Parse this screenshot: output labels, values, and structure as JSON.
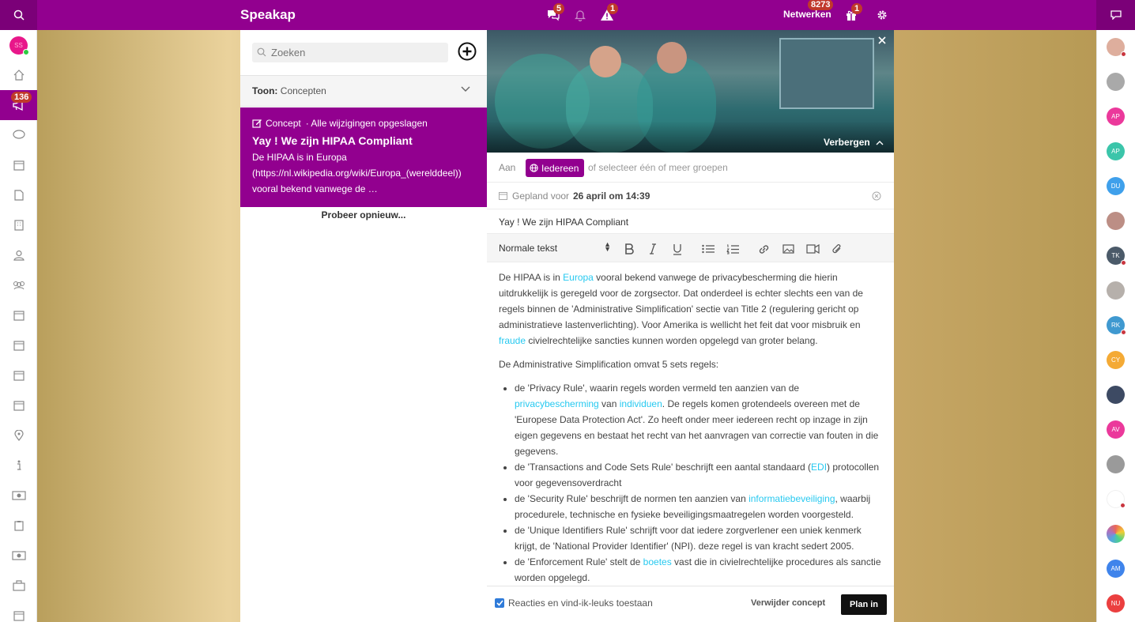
{
  "app": {
    "title": "Speakap"
  },
  "topbar": {
    "chat_badge": "5",
    "alert_badge": "1",
    "network_label": "Netwerken",
    "network_count": "8273",
    "gift_badge": "1"
  },
  "leftnav": {
    "avatar_initials": "SS",
    "active_badge": "136"
  },
  "list": {
    "search_placeholder": "Zoeken",
    "filter_label": "Toon:",
    "filter_value": "Concepten",
    "card": {
      "status": "Concept",
      "saved": "· Alle wijzigingen opgeslagen",
      "title": "Yay ! We zijn HIPAA Compliant",
      "line1": "De HIPAA is in Europa",
      "line2": "(https://nl.wikipedia.org/wiki/Europa_(werelddeel))",
      "line3": "vooral bekend vanwege de …"
    },
    "retry": "Probeer opnieuw..."
  },
  "editor": {
    "hide_label": "Verbergen",
    "to_label": "Aan",
    "audience": "Iedereen",
    "audience_hint": "of selecteer één of meer groepen",
    "schedule_label": "Gepland voor",
    "schedule_value": "26 april om 14:39",
    "title": "Yay ! We zijn HIPAA Compliant",
    "format": "Normale tekst",
    "p1a": "De HIPAA is in ",
    "p1_link1": "Europa",
    "p1b": " vooral bekend vanwege de privacybescherming die hierin uitdrukkelijk is geregeld voor de zorgsector. Dat onderdeel is echter slechts een van de regels binnen de 'Administrative Simplification' sectie van Title 2 (regulering gericht op administratieve lastenverlichting). Voor Amerika is wellicht het feit dat voor misbruik en ",
    "p1_link2": "fraude",
    "p1c": " civielrechtelijke sancties kunnen worden opgelegd van groter belang.",
    "p2": "De Administrative Simplification omvat 5 sets regels:",
    "li1a": "de 'Privacy Rule', waarin regels worden vermeld ten aanzien van de ",
    "li1_link1": "privacybescherming",
    "li1b": " van ",
    "li1_link2": "individuen",
    "li1c": ". De regels komen grotendeels overeen met de 'Europese Data Protection Act'. Zo heeft onder meer iedereen recht op inzage in zijn eigen gegevens en bestaat het recht van het aanvragen van correctie van fouten in die gegevens.",
    "li2a": "de 'Transactions and Code Sets Rule' beschrijft een aantal standaard (",
    "li2_link": "EDI",
    "li2b": ") protocollen voor gegevensoverdracht",
    "li3a": "de 'Security Rule' beschrijft de normen ten aanzien van ",
    "li3_link": "informatiebeveiliging",
    "li3b": ", waarbij procedurele, technische en fysieke beveiligingsmaatregelen worden voorgesteld.",
    "li4": "de 'Unique Identifiers Rule' schrijft voor dat iedere zorgverlener een uniek kenmerk krijgt, de 'National Provider Identifier' (NPI). deze regel is van kracht sedert 2005.",
    "li5a": "de 'Enforcement Rule' stelt de ",
    "li5_link": "boetes",
    "li5b": " vast die in civielrechtelijke procedures als sanctie worden opgelegd.",
    "allow_comments": "Reacties en vind-ik-leuks toestaan",
    "delete_label": "Verwijder concept",
    "schedule_button": "Plan in"
  },
  "contacts": [
    "",
    "",
    "AP",
    "AP",
    "DU",
    "",
    "TK",
    "",
    "RK",
    "CY",
    "",
    "AV",
    "",
    "",
    "",
    "AM",
    "NU"
  ],
  "colors": {
    "brand": "#92008f",
    "brand_dark": "#7b0078",
    "link": "#27c9f0",
    "badge": "#c0392b"
  }
}
